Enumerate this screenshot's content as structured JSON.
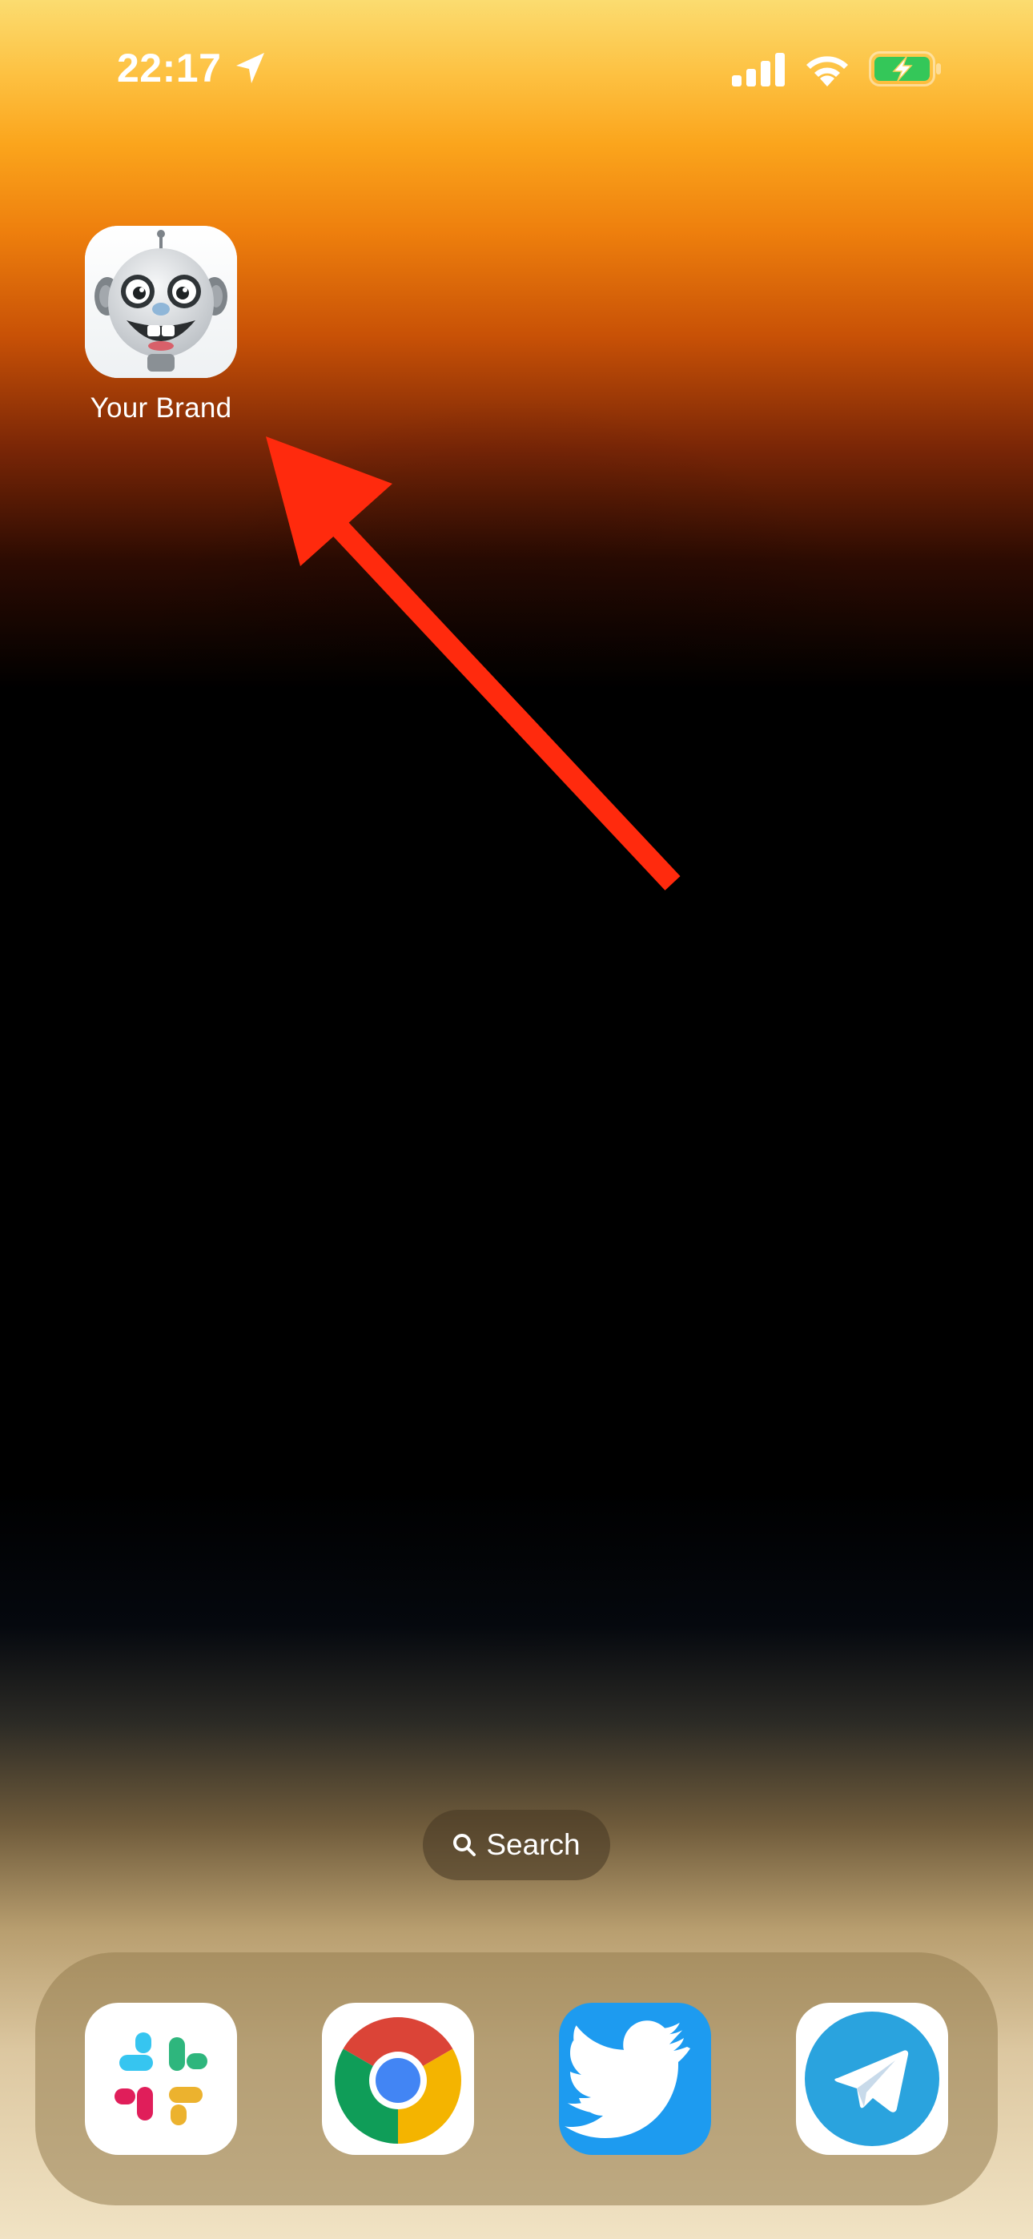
{
  "status_bar": {
    "time": "22:17",
    "icons": [
      "location-arrow-icon",
      "cellular-signal-icon",
      "wifi-icon",
      "battery-charging-icon"
    ],
    "battery_color": "#34c759"
  },
  "home_screen": {
    "apps": [
      {
        "label": "Your Brand",
        "icon": "robot-app-icon"
      }
    ],
    "annotation": {
      "icon": "red-arrow-icon",
      "color": "#ff2a0d"
    }
  },
  "search": {
    "label": "Search",
    "icon": "search-icon"
  },
  "dock": {
    "apps": [
      {
        "name": "Slack",
        "icon": "slack-icon"
      },
      {
        "name": "Chrome",
        "icon": "chrome-icon"
      },
      {
        "name": "Twitter",
        "icon": "twitter-icon",
        "color": "#1d9bf0"
      },
      {
        "name": "Telegram",
        "icon": "telegram-icon",
        "color": "#2aa3de"
      }
    ]
  }
}
